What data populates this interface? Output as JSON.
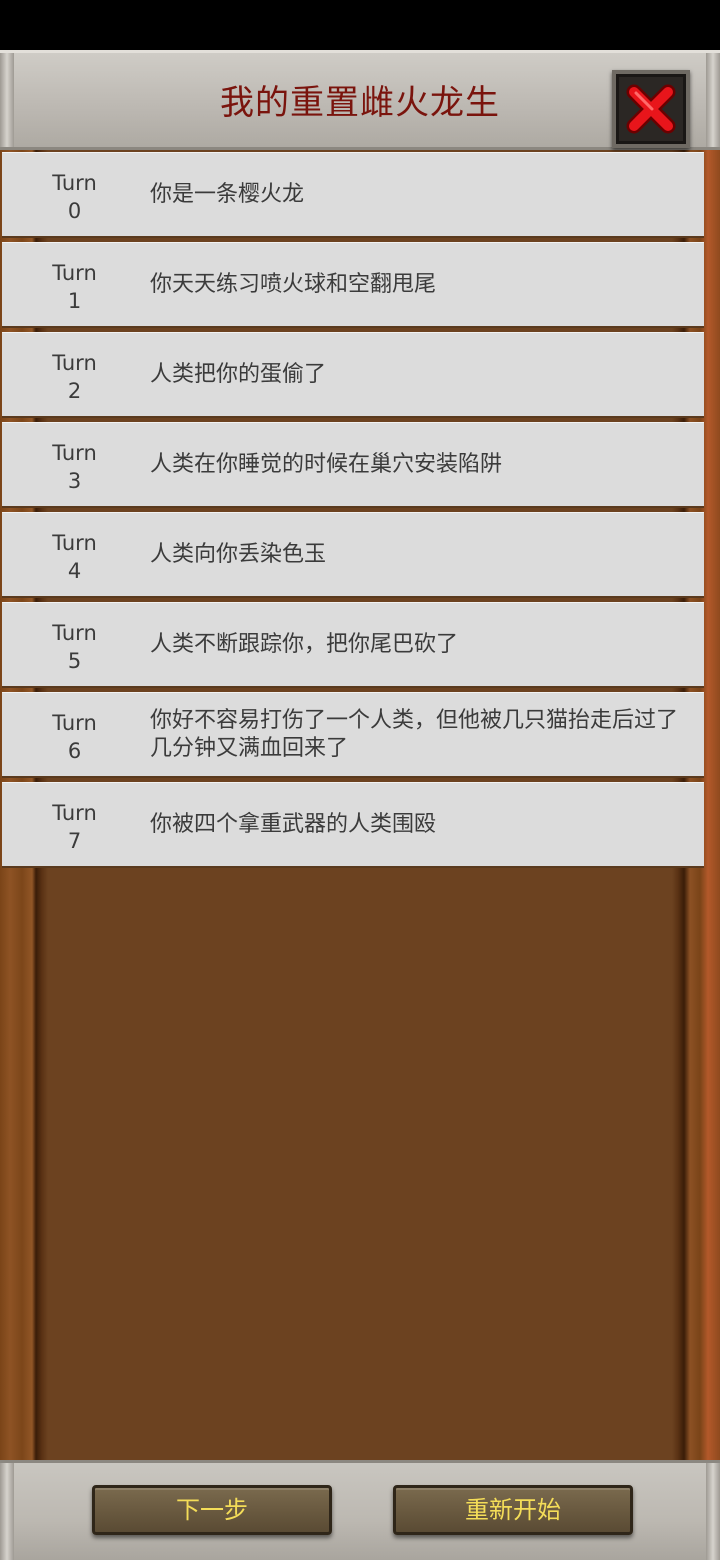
{
  "header": {
    "title": "我的重置雌火龙生"
  },
  "turns": [
    {
      "label": "Turn",
      "number": "0",
      "text": "你是一条樱火龙"
    },
    {
      "label": "Turn",
      "number": "1",
      "text": "你天天练习喷火球和空翻甩尾"
    },
    {
      "label": "Turn",
      "number": "2",
      "text": "人类把你的蛋偷了"
    },
    {
      "label": "Turn",
      "number": "3",
      "text": "人类在你睡觉的时候在巢穴安装陷阱"
    },
    {
      "label": "Turn",
      "number": "4",
      "text": "人类向你丢染色玉"
    },
    {
      "label": "Turn",
      "number": "5",
      "text": "人类不断跟踪你，把你尾巴砍了"
    },
    {
      "label": "Turn",
      "number": "6",
      "text": "你好不容易打伤了一个人类，但他被几只猫抬走后过了几分钟又满血回来了"
    },
    {
      "label": "Turn",
      "number": "7",
      "text": "你被四个拿重武器的人类围殴"
    }
  ],
  "footer": {
    "next_label": "下一步",
    "restart_label": "重新开始"
  },
  "colors": {
    "title": "#7a140d",
    "button_text": "#f4dd58",
    "close_red": "#e8151b"
  },
  "icons": {
    "close": "close-icon"
  }
}
